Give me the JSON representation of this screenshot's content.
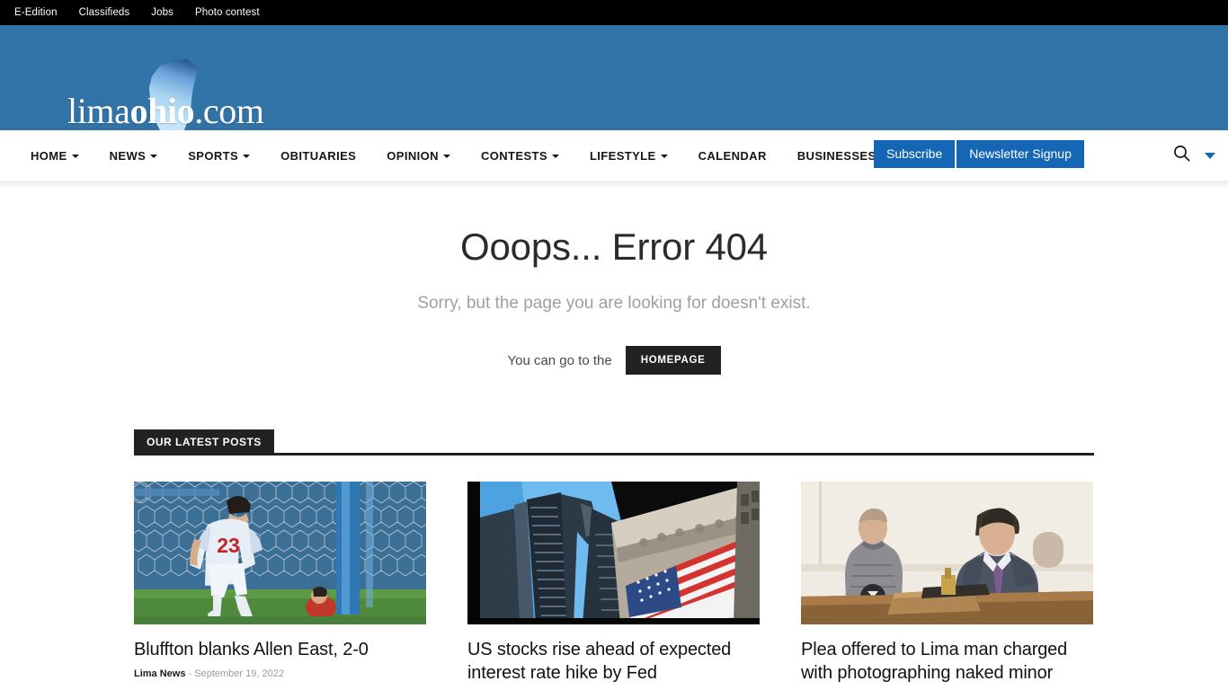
{
  "topbar": {
    "links": [
      {
        "label": "E-Edition"
      },
      {
        "label": "Classifieds"
      },
      {
        "label": "Jobs"
      },
      {
        "label": "Photo contest"
      }
    ]
  },
  "masthead": {
    "logo_text_light": "lima",
    "logo_text_bold": "ohio",
    "logo_text_tail": ".com",
    "background_color": "#3173a6"
  },
  "nav": {
    "items": [
      {
        "label": "HOME",
        "has_dropdown": true
      },
      {
        "label": "NEWS",
        "has_dropdown": true
      },
      {
        "label": "SPORTS",
        "has_dropdown": true
      },
      {
        "label": "OBITUARIES",
        "has_dropdown": false
      },
      {
        "label": "OPINION",
        "has_dropdown": true
      },
      {
        "label": "CONTESTS",
        "has_dropdown": true
      },
      {
        "label": "LIFESTYLE",
        "has_dropdown": true
      },
      {
        "label": "CALENDAR",
        "has_dropdown": false
      },
      {
        "label": "BUSINESSES",
        "has_dropdown": true
      }
    ],
    "subscribe_label": "Subscribe",
    "newsletter_label": "Newsletter Signup",
    "button_color": "#1567b5",
    "search_icon": "search-icon",
    "dropdown_icon": "chevron-down-icon"
  },
  "error": {
    "title": "Ooops... Error 404",
    "subtitle": "Sorry, but the page you are looking for doesn't exist.",
    "cta_prefix": "You can go to the",
    "cta_button": "HOMEPAGE"
  },
  "latest": {
    "section_title": "OUR LATEST POSTS",
    "posts": [
      {
        "title": "Bluffton blanks Allen East, 2-0",
        "author": "Lima News",
        "separator": "-",
        "date": "September 19, 2022",
        "image_alt": "soccer-player-number-23-at-goal-net"
      },
      {
        "title": "US stocks rise ahead of expected interest rate hike by Fed",
        "author": "",
        "separator": "",
        "date": "",
        "image_alt": "new-york-stock-exchange-american-flag"
      },
      {
        "title": "Plea offered to Lima man charged with photographing naked minor",
        "author": "",
        "separator": "",
        "date": "",
        "image_alt": "courtroom-defendant-and-attorney"
      }
    ]
  }
}
